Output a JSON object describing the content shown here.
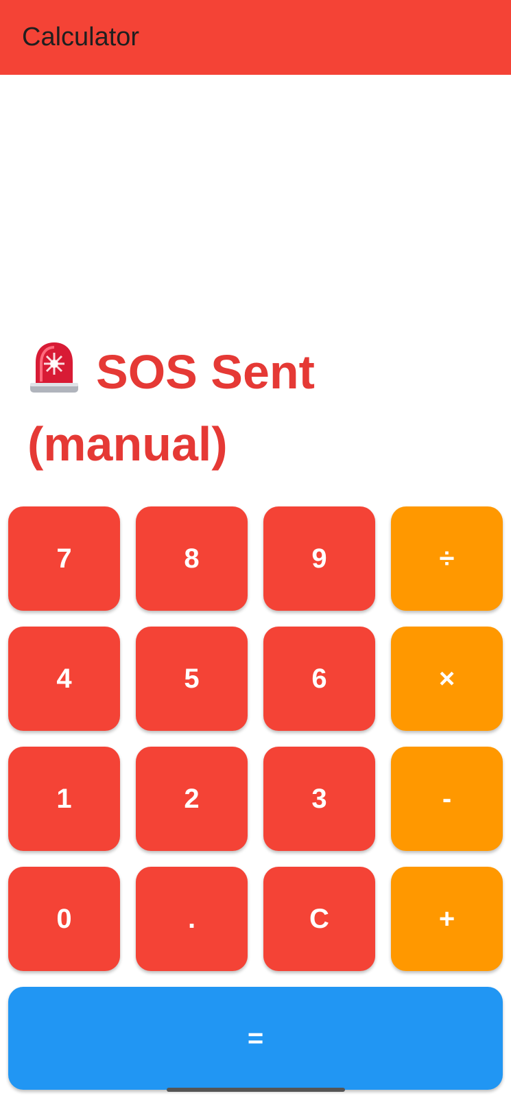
{
  "app_bar": {
    "title": "Calculator",
    "background": "#f44336"
  },
  "display": {
    "icon": "police-siren-icon",
    "text": "SOS Sent (manual)",
    "color": "#e53935"
  },
  "keypad": {
    "keys": [
      {
        "label": "7",
        "kind": "digit"
      },
      {
        "label": "8",
        "kind": "digit"
      },
      {
        "label": "9",
        "kind": "digit"
      },
      {
        "label": "÷",
        "kind": "operator"
      },
      {
        "label": "4",
        "kind": "digit"
      },
      {
        "label": "5",
        "kind": "digit"
      },
      {
        "label": "6",
        "kind": "digit"
      },
      {
        "label": "×",
        "kind": "operator"
      },
      {
        "label": "1",
        "kind": "digit"
      },
      {
        "label": "2",
        "kind": "digit"
      },
      {
        "label": "3",
        "kind": "digit"
      },
      {
        "label": "-",
        "kind": "operator"
      },
      {
        "label": "0",
        "kind": "digit"
      },
      {
        "label": ".",
        "kind": "digit"
      },
      {
        "label": "C",
        "kind": "digit"
      },
      {
        "label": "+",
        "kind": "operator"
      }
    ],
    "digit_color": "#f44336",
    "operator_color": "#ff9800"
  },
  "equals": {
    "label": "=",
    "color": "#2196f3"
  }
}
